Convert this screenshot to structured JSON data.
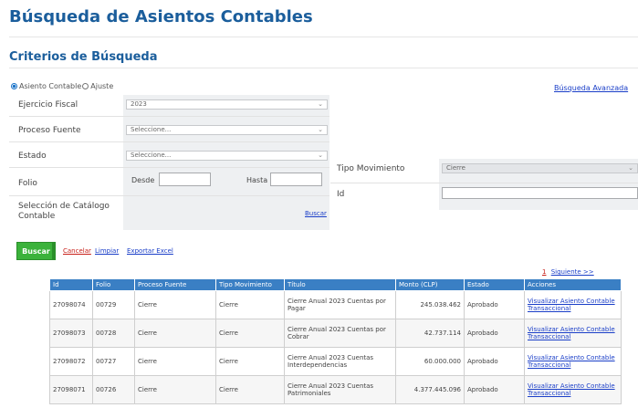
{
  "page": {
    "title": "Búsqueda de Asientos Contables"
  },
  "criteria": {
    "title": "Criterios de Búsqueda",
    "radio_asiento": "Asiento Contable",
    "radio_ajuste": "Ajuste",
    "advanced_link": "Búsqueda Avanzada",
    "ejercicio_label": "Ejercicio Fiscal",
    "ejercicio_value": "2023",
    "proceso_label": "Proceso Fuente",
    "proceso_value": "Seleccione...",
    "estado_label": "Estado",
    "estado_value": "Seleccione...",
    "tipo_label": "Tipo Movimiento",
    "tipo_value": "Cierre",
    "folio_label": "Folio",
    "desde_label": "Desde",
    "hasta_label": "Hasta",
    "id_label": "Id",
    "catalogo_label": "Selección de Catálogo Contable",
    "catalogo_link": "Buscar"
  },
  "actions": {
    "buscar": "Buscar",
    "cancelar": "Cancelar",
    "limpiar": "Limpiar",
    "exportar": "Exportar Excel"
  },
  "pager": {
    "current": "1",
    "next": "Siguiente >>"
  },
  "table": {
    "headers": [
      "Id",
      "Folio",
      "Proceso Fuente",
      "Tipo Movimiento",
      "Título",
      "Monto (CLP)",
      "Estado",
      "Acciones"
    ],
    "rows": [
      {
        "id": "27098074",
        "folio": "00729",
        "proceso": "Cierre",
        "tipo": "Cierre",
        "titulo": "Cierre Anual 2023 Cuentas por Pagar",
        "monto": "245.038.462",
        "estado": "Aprobado",
        "accion": "Visualizar Asiento Contable Transaccional"
      },
      {
        "id": "27098073",
        "folio": "00728",
        "proceso": "Cierre",
        "tipo": "Cierre",
        "titulo": "Cierre Anual 2023 Cuentas por Cobrar",
        "monto": "42.737.114",
        "estado": "Aprobado",
        "accion": "Visualizar Asiento Contable Transaccional"
      },
      {
        "id": "27098072",
        "folio": "00727",
        "proceso": "Cierre",
        "tipo": "Cierre",
        "titulo": "Cierre Anual 2023 Cuentas Interdependencias",
        "monto": "60.000.000",
        "estado": "Aprobado",
        "accion": "Visualizar Asiento Contable Transaccional"
      },
      {
        "id": "27098071",
        "folio": "00726",
        "proceso": "Cierre",
        "tipo": "Cierre",
        "titulo": "Cierre Anual 2023 Cuentas Patrimoniales",
        "monto": "4.377.445.096",
        "estado": "Aprobado",
        "accion": "Visualizar Asiento Contable Transaccional"
      }
    ]
  }
}
